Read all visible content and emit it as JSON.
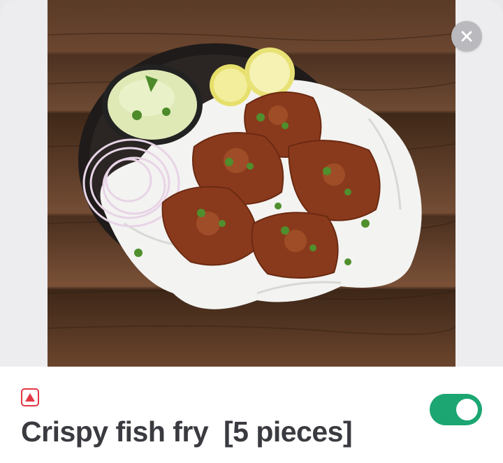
{
  "item": {
    "title": "Crispy fish fry  [5 pieces]",
    "food_type_icon": "non-veg-triangle-icon",
    "photo_icon": "food-photo-image",
    "available": true
  },
  "controls": {
    "close_icon": "close-icon",
    "toggle_state": "on"
  },
  "colors": {
    "non_veg_red": "#e23744",
    "toggle_green": "#1ba672",
    "title_text": "#3a3b40",
    "close_bg": "#b9b9be"
  }
}
